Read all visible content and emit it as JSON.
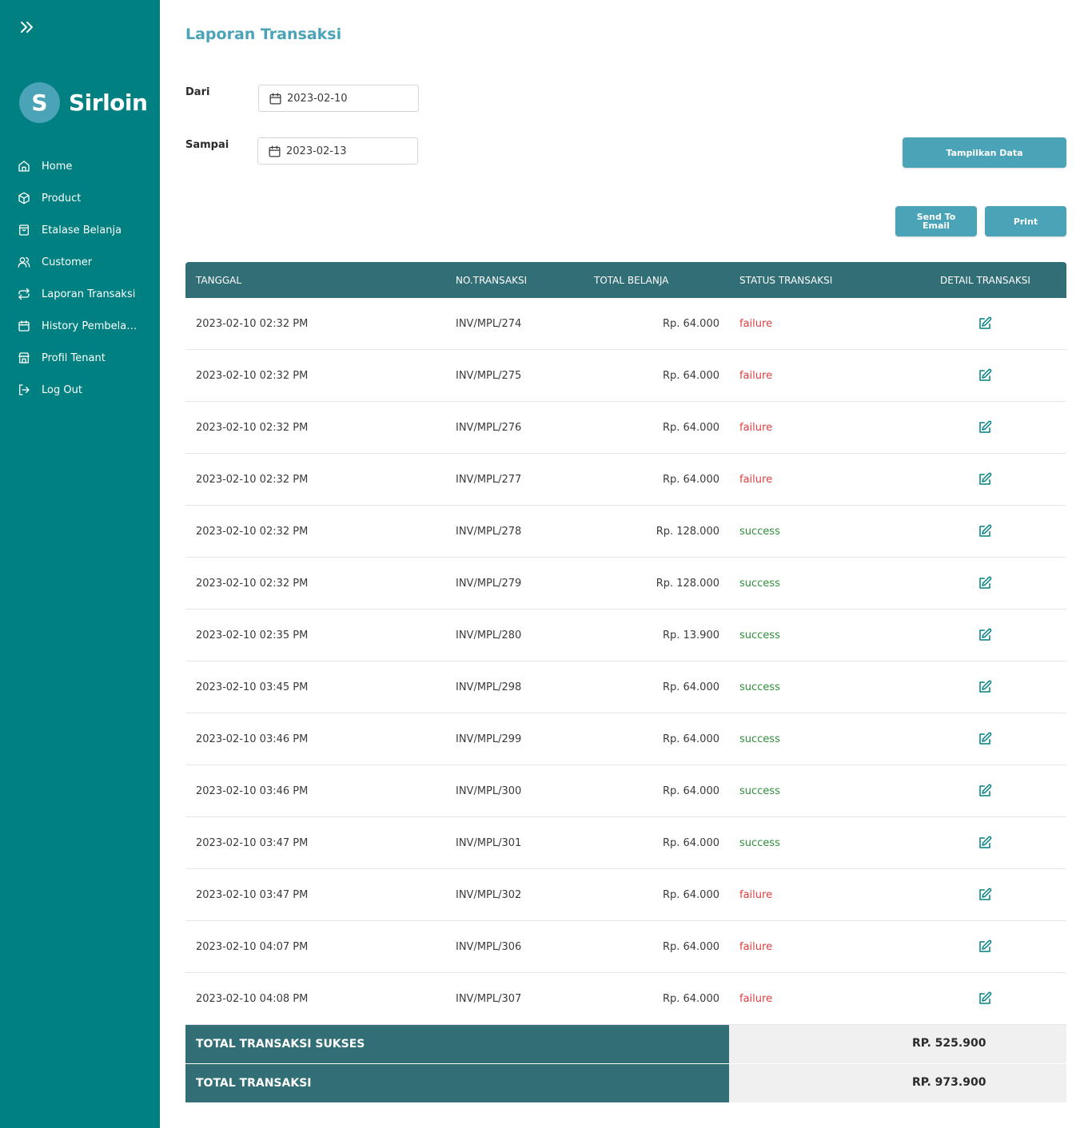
{
  "sidebar": {
    "brand": {
      "letter": "S",
      "name": "Sirloin"
    },
    "items": [
      {
        "label": "Home",
        "icon": "home-icon"
      },
      {
        "label": "Product",
        "icon": "box-icon"
      },
      {
        "label": "Etalase Belanja",
        "icon": "shopping-bag-icon"
      },
      {
        "label": "Customer",
        "icon": "users-icon"
      },
      {
        "label": "Laporan Transaksi",
        "icon": "repeat-icon"
      },
      {
        "label": "History Pembelanjaan",
        "icon": "calendar-icon"
      },
      {
        "label": "Profil Tenant",
        "icon": "store-icon"
      },
      {
        "label": "Log Out",
        "icon": "logout-icon"
      }
    ]
  },
  "page": {
    "title": "Laporan Transaksi"
  },
  "filter": {
    "from_label": "Dari",
    "from_value": "2023-02-10",
    "to_label": "Sampai",
    "to_value": "2023-02-13",
    "show_button": "Tampilkan Data",
    "email_button": "Send To Email",
    "print_button": "Print"
  },
  "table": {
    "headers": [
      "TANGGAL",
      "NO.TRANSAKSI",
      "TOTAL BELANJA",
      "STATUS TRANSAKSI",
      "DETAIL TRANSAKSI"
    ],
    "rows": [
      {
        "date": "2023-02-10 02:32 PM",
        "inv": "INV/MPL/274",
        "total": "Rp. 64.000",
        "status": "failure"
      },
      {
        "date": "2023-02-10 02:32 PM",
        "inv": "INV/MPL/275",
        "total": "Rp. 64.000",
        "status": "failure"
      },
      {
        "date": "2023-02-10 02:32 PM",
        "inv": "INV/MPL/276",
        "total": "Rp. 64.000",
        "status": "failure"
      },
      {
        "date": "2023-02-10 02:32 PM",
        "inv": "INV/MPL/277",
        "total": "Rp. 64.000",
        "status": "failure"
      },
      {
        "date": "2023-02-10 02:32 PM",
        "inv": "INV/MPL/278",
        "total": "Rp. 128.000",
        "status": "success"
      },
      {
        "date": "2023-02-10 02:32 PM",
        "inv": "INV/MPL/279",
        "total": "Rp. 128.000",
        "status": "success"
      },
      {
        "date": "2023-02-10 02:35 PM",
        "inv": "INV/MPL/280",
        "total": "Rp. 13.900",
        "status": "success"
      },
      {
        "date": "2023-02-10 03:45 PM",
        "inv": "INV/MPL/298",
        "total": "Rp. 64.000",
        "status": "success"
      },
      {
        "date": "2023-02-10 03:46 PM",
        "inv": "INV/MPL/299",
        "total": "Rp. 64.000",
        "status": "success"
      },
      {
        "date": "2023-02-10 03:46 PM",
        "inv": "INV/MPL/300",
        "total": "Rp. 64.000",
        "status": "success"
      },
      {
        "date": "2023-02-10 03:47 PM",
        "inv": "INV/MPL/301",
        "total": "Rp. 64.000",
        "status": "success"
      },
      {
        "date": "2023-02-10 03:47 PM",
        "inv": "INV/MPL/302",
        "total": "Rp. 64.000",
        "status": "failure"
      },
      {
        "date": "2023-02-10 04:07 PM",
        "inv": "INV/MPL/306",
        "total": "Rp. 64.000",
        "status": "failure"
      },
      {
        "date": "2023-02-10 04:08 PM",
        "inv": "INV/MPL/307",
        "total": "Rp. 64.000",
        "status": "failure"
      }
    ],
    "detail_icon": "edit-icon"
  },
  "summary": {
    "success_label": "TOTAL TRANSAKSI SUKSES",
    "success_value": "RP. 525.900",
    "total_label": "TOTAL TRANSAKSI",
    "total_value": "RP. 973.900"
  },
  "colors": {
    "sidebar": "#008080",
    "accent": "#4ba3b8",
    "table_header": "#326e75",
    "failure": "#e03c3c",
    "success": "#2f8f3a"
  }
}
